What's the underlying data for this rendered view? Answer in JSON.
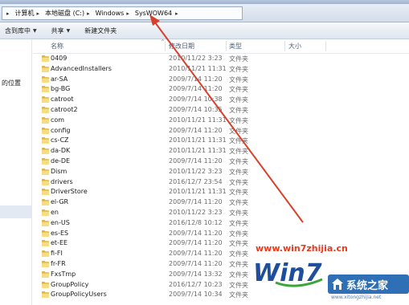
{
  "breadcrumb": {
    "items": [
      "计算机",
      "本地磁盘 (C:)",
      "Windows",
      "SysWOW64"
    ]
  },
  "toolbar": {
    "include_library_label": "含到库中",
    "share_label": "共享",
    "new_folder_label": "新建文件夹"
  },
  "nav": {
    "partial_label": "的位置"
  },
  "columns": {
    "name": "名称",
    "date": "修改日期",
    "type": "类型",
    "size": "大小"
  },
  "files": [
    {
      "name": "0409",
      "date": "2010/11/22 3:23",
      "type": "文件夹"
    },
    {
      "name": "AdvancedInstallers",
      "date": "2010/11/21 11:31",
      "type": "文件夹"
    },
    {
      "name": "ar-SA",
      "date": "2009/7/14 11:20",
      "type": "文件夹"
    },
    {
      "name": "bg-BG",
      "date": "2009/7/14 11:20",
      "type": "文件夹"
    },
    {
      "name": "catroot",
      "date": "2009/7/14 10:38",
      "type": "文件夹"
    },
    {
      "name": "catroot2",
      "date": "2009/7/14 10:35",
      "type": "文件夹"
    },
    {
      "name": "com",
      "date": "2010/11/21 11:31",
      "type": "文件夹"
    },
    {
      "name": "config",
      "date": "2009/7/14 11:20",
      "type": "文件夹"
    },
    {
      "name": "cs-CZ",
      "date": "2010/11/21 11:31",
      "type": "文件夹"
    },
    {
      "name": "da-DK",
      "date": "2010/11/21 11:31",
      "type": "文件夹"
    },
    {
      "name": "de-DE",
      "date": "2009/7/14 11:20",
      "type": "文件夹"
    },
    {
      "name": "Dism",
      "date": "2010/11/22 3:23",
      "type": "文件夹"
    },
    {
      "name": "drivers",
      "date": "2016/12/7 23:54",
      "type": "文件夹"
    },
    {
      "name": "DriverStore",
      "date": "2010/11/21 11:31",
      "type": "文件夹"
    },
    {
      "name": "el-GR",
      "date": "2009/7/14 11:20",
      "type": "文件夹"
    },
    {
      "name": "en",
      "date": "2010/11/22 3:23",
      "type": "文件夹"
    },
    {
      "name": "en-US",
      "date": "2016/12/8 10:12",
      "type": "文件夹"
    },
    {
      "name": "es-ES",
      "date": "2009/7/14 11:20",
      "type": "文件夹"
    },
    {
      "name": "et-EE",
      "date": "2009/7/14 11:20",
      "type": "文件夹"
    },
    {
      "name": "fi-FI",
      "date": "2009/7/14 11:20",
      "type": "文件夹"
    },
    {
      "name": "fr-FR",
      "date": "2009/7/14 11:20",
      "type": "文件夹"
    },
    {
      "name": "FxsTmp",
      "date": "2009/7/14 13:32",
      "type": "文件夹"
    },
    {
      "name": "GroupPolicy",
      "date": "2016/12/7 10:23",
      "type": "文件夹"
    },
    {
      "name": "GroupPolicyUsers",
      "date": "2009/7/14 10:34",
      "type": "文件夹"
    }
  ],
  "watermark": {
    "url": "www.win7zhijia.cn",
    "logo_text": "Win7",
    "badge_text": "系统之家",
    "sub_text": "www.xitongzhijia.net"
  },
  "colors": {
    "accent": "#e63b1f",
    "folder": "#e7c55a",
    "header_text": "#4c607a",
    "badge": "#2f6fb5"
  }
}
